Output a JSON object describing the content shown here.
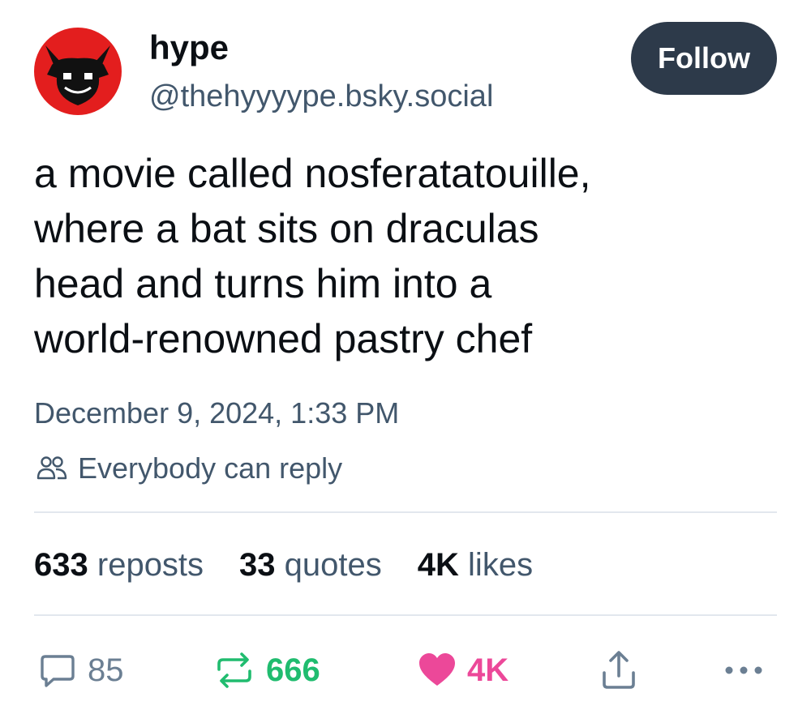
{
  "author": {
    "display_name": "hype",
    "handle": "@thehyyyype.bsky.social",
    "avatar_icon": "red-devil-avatar-icon"
  },
  "follow_button": {
    "label": "Follow"
  },
  "post": {
    "text_lines": [
      "a movie called nosferatatouille,",
      "where a bat sits on draculas",
      "head and turns him into a",
      "world-renowned pastry chef"
    ],
    "timestamp": "December 9, 2024, 1:33 PM",
    "reply_setting": "Everybody can reply"
  },
  "stats": {
    "reposts": {
      "count": "633",
      "label": "reposts"
    },
    "quotes": {
      "count": "33",
      "label": "quotes"
    },
    "likes": {
      "count": "4K",
      "label": "likes"
    }
  },
  "actions": {
    "reply_count": "85",
    "repost_count": "666",
    "like_count": "4K"
  },
  "colors": {
    "accent_dark": "#2d3a4a",
    "muted_text": "#42576c",
    "repost_green": "#20bc6f",
    "like_pink": "#ec4899",
    "avatar_red": "#e31e1e"
  }
}
